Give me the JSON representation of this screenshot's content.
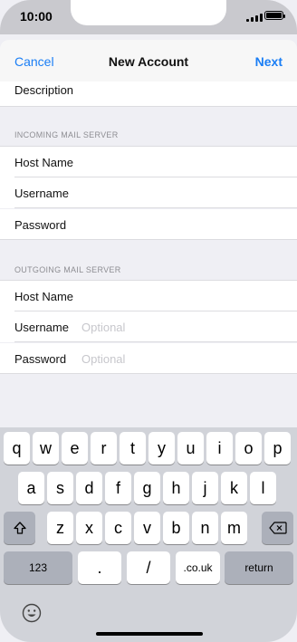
{
  "status_bar": {
    "time": "10:00"
  },
  "nav": {
    "cancel_label": "Cancel",
    "title": "New Account",
    "next_label": "Next"
  },
  "form": {
    "description_label": "Description",
    "incoming_header": "INCOMING MAIL SERVER",
    "incoming": {
      "host_label": "Host Name",
      "username_label": "Username",
      "password_label": "Password"
    },
    "outgoing_header": "OUTGOING MAIL SERVER",
    "outgoing": {
      "host_label": "Host Name",
      "username_label": "Username",
      "username_placeholder": "Optional",
      "password_label": "Password",
      "password_placeholder": "Optional"
    }
  },
  "keyboard": {
    "row1": [
      "q",
      "w",
      "e",
      "r",
      "t",
      "y",
      "u",
      "i",
      "o",
      "p"
    ],
    "row2": [
      "a",
      "s",
      "d",
      "f",
      "g",
      "h",
      "j",
      "k",
      "l"
    ],
    "row3": [
      "z",
      "x",
      "c",
      "v",
      "b",
      "n",
      "m"
    ],
    "numbers_label": "123",
    "dot_label": ".",
    "slash_label": "/",
    "couk_label": ".co.uk",
    "return_label": "return"
  },
  "colors": {
    "accent": "#1a7ef5",
    "background": "#efeff4",
    "keyboard_bg": "#d1d3d9"
  }
}
